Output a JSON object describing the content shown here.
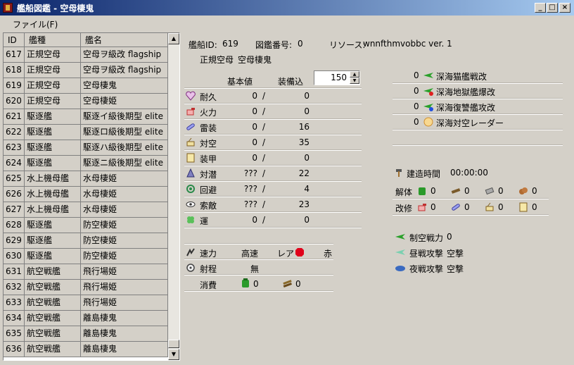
{
  "window": {
    "title": "艦船図鑑 - 空母棲鬼"
  },
  "menu": {
    "file": "ファイル(F)"
  },
  "list": {
    "headers": [
      "ID",
      "艦種",
      "艦名"
    ],
    "rows": [
      [
        "617",
        "正規空母",
        "空母ヲ級改 flagship"
      ],
      [
        "618",
        "正規空母",
        "空母ヲ級改 flagship"
      ],
      [
        "619",
        "正規空母",
        "空母棲鬼"
      ],
      [
        "620",
        "正規空母",
        "空母棲姫"
      ],
      [
        "621",
        "駆逐艦",
        "駆逐イ級後期型 elite"
      ],
      [
        "622",
        "駆逐艦",
        "駆逐ロ級後期型 elite"
      ],
      [
        "623",
        "駆逐艦",
        "駆逐ハ級後期型 elite"
      ],
      [
        "624",
        "駆逐艦",
        "駆逐ニ級後期型 elite"
      ],
      [
        "625",
        "水上機母艦",
        "水母棲姫"
      ],
      [
        "626",
        "水上機母艦",
        "水母棲姫"
      ],
      [
        "627",
        "水上機母艦",
        "水母棲姫"
      ],
      [
        "628",
        "駆逐艦",
        "防空棲姫"
      ],
      [
        "629",
        "駆逐艦",
        "防空棲姫"
      ],
      [
        "630",
        "駆逐艦",
        "防空棲姫"
      ],
      [
        "631",
        "航空戦艦",
        "飛行場姫"
      ],
      [
        "632",
        "航空戦艦",
        "飛行場姫"
      ],
      [
        "633",
        "航空戦艦",
        "飛行場姫"
      ],
      [
        "634",
        "航空戦艦",
        "離島棲鬼"
      ],
      [
        "635",
        "航空戦艦",
        "離島棲鬼"
      ],
      [
        "636",
        "航空戦艦",
        "離島棲鬼"
      ]
    ]
  },
  "detail": {
    "ship_id_label": "艦船ID:",
    "ship_id": "619",
    "zukan_label": "図鑑番号:",
    "zukan": "0",
    "resource_label": "リソース:",
    "resource": "wnnfthmvobbc ver. 1",
    "ship_type": "正規空母",
    "ship_name": "空母棲鬼",
    "col_base": "基本値",
    "col_equip": "装備込",
    "level": "150",
    "stats": [
      {
        "icon": "heart-icon",
        "label": "耐久",
        "base": "0",
        "equip": "0"
      },
      {
        "icon": "firepower-icon",
        "label": "火力",
        "base": "0",
        "equip": "0"
      },
      {
        "icon": "torpedo-icon",
        "label": "雷装",
        "base": "0",
        "equip": "16"
      },
      {
        "icon": "antiair-icon",
        "label": "対空",
        "base": "0",
        "equip": "35"
      },
      {
        "icon": "armor-icon",
        "label": "装甲",
        "base": "0",
        "equip": "0"
      },
      {
        "icon": "asw-icon",
        "label": "対潜",
        "base": "???",
        "equip": "22"
      },
      {
        "icon": "evasion-icon",
        "label": "回避",
        "base": "???",
        "equip": "4"
      },
      {
        "icon": "los-icon",
        "label": "索敵",
        "base": "???",
        "equip": "23"
      },
      {
        "icon": "luck-icon",
        "label": "運",
        "base": "0",
        "equip": "0"
      }
    ],
    "slash": "/",
    "speed_label": "速力",
    "speed": "高速",
    "rarity_label": "レア",
    "rarity_value": "赤",
    "range_label": "射程",
    "range": "無",
    "consume_label": "消費",
    "consume_fuel": "0",
    "consume_ammo": "0",
    "equipment": [
      {
        "count": "0",
        "name": "深海猫艦戦改",
        "icon": "fighter-green-icon"
      },
      {
        "count": "0",
        "name": "深海地獄艦爆改",
        "icon": "bomber-red-icon"
      },
      {
        "count": "0",
        "name": "深海復讐艦攻改",
        "icon": "torpedo-bomber-blue-icon"
      },
      {
        "count": "0",
        "name": "深海対空レーダー",
        "icon": "radar-icon"
      }
    ],
    "build_label": "建造時間",
    "build_time": "00:00:00",
    "dismantle_label": "解体",
    "dismantle": [
      "0",
      "0",
      "0",
      "0"
    ],
    "modernize_label": "改修",
    "modernize": [
      "0",
      "0",
      "0",
      "0"
    ],
    "air_power_label": "制空戦力",
    "air_power": "0",
    "day_attack_label": "昼戦攻撃",
    "day_attack": "空撃",
    "night_attack_label": "夜戦攻撃",
    "night_attack": "空撃"
  },
  "colors": {
    "titlebar_start": "#0a246a",
    "titlebar_end": "#a6caf0",
    "window_bg": "#d4d0c8",
    "rarity_red": "#e0001a"
  }
}
